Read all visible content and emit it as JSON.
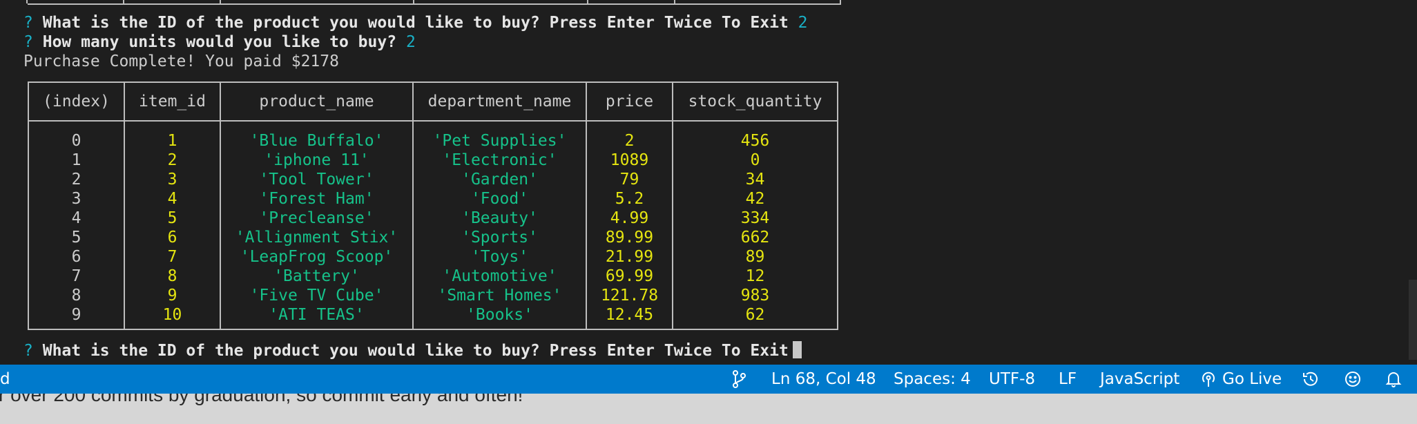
{
  "terminal": {
    "prompt_symbol": "?",
    "question1": "What is the ID of the product you would like to buy? Press Enter Twice To Exit",
    "answer1": "2",
    "question2": "How many units would you like to buy?",
    "answer2": "2",
    "purchase_message": "Purchase Complete! You paid $2178",
    "table": {
      "headers": [
        "(index)",
        "item_id",
        "product_name",
        "department_name",
        "price",
        "stock_quantity"
      ],
      "rows": [
        {
          "index": "0",
          "item_id": "1",
          "product_name": "'Blue Buffalo'",
          "department_name": "'Pet Supplies'",
          "price": "2",
          "stock_quantity": "456"
        },
        {
          "index": "1",
          "item_id": "2",
          "product_name": "'iphone 11'",
          "department_name": "'Electronic'",
          "price": "1089",
          "stock_quantity": "0"
        },
        {
          "index": "2",
          "item_id": "3",
          "product_name": "'Tool Tower'",
          "department_name": "'Garden'",
          "price": "79",
          "stock_quantity": "34"
        },
        {
          "index": "3",
          "item_id": "4",
          "product_name": "'Forest Ham'",
          "department_name": "'Food'",
          "price": "5.2",
          "stock_quantity": "42"
        },
        {
          "index": "4",
          "item_id": "5",
          "product_name": "'Precleanse'",
          "department_name": "'Beauty'",
          "price": "4.99",
          "stock_quantity": "334"
        },
        {
          "index": "5",
          "item_id": "6",
          "product_name": "'Allignment Stix'",
          "department_name": "'Sports'",
          "price": "89.99",
          "stock_quantity": "662"
        },
        {
          "index": "6",
          "item_id": "7",
          "product_name": "'LeapFrog Scoop'",
          "department_name": "'Toys'",
          "price": "21.99",
          "stock_quantity": "89"
        },
        {
          "index": "7",
          "item_id": "8",
          "product_name": "'Battery'",
          "department_name": "'Automotive'",
          "price": "69.99",
          "stock_quantity": "12"
        },
        {
          "index": "8",
          "item_id": "9",
          "product_name": "'Five TV Cube'",
          "department_name": "'Smart Homes'",
          "price": "121.78",
          "stock_quantity": "983"
        },
        {
          "index": "9",
          "item_id": "10",
          "product_name": "'ATI TEAS'",
          "department_name": "'Books'",
          "price": "12.45",
          "stock_quantity": "62"
        }
      ]
    },
    "question3": "What is the ID of the product you would like to buy? Press Enter Twice To Exit"
  },
  "statusbar": {
    "left_fragment": "d",
    "branch_icon": "source-control-icon",
    "position": "Ln 68, Col 48",
    "spaces": "Spaces: 4",
    "encoding": "UTF-8",
    "eol": "LF",
    "language": "JavaScript",
    "go_live": "Go Live",
    "go_live_icon": "broadcast-icon",
    "history_icon": "history-icon",
    "feedback_icon": "smiley-icon",
    "notifications_icon": "bell-icon"
  },
  "background_text": "r over 200 commits by graduation, so commit early and often!",
  "colors": {
    "terminal_bg": "#1e1e1e",
    "statusbar_bg": "#007acc",
    "number_yellow": "#e5e510",
    "string_green": "#16c28a",
    "prompt_cyan": "#19b1c7"
  }
}
